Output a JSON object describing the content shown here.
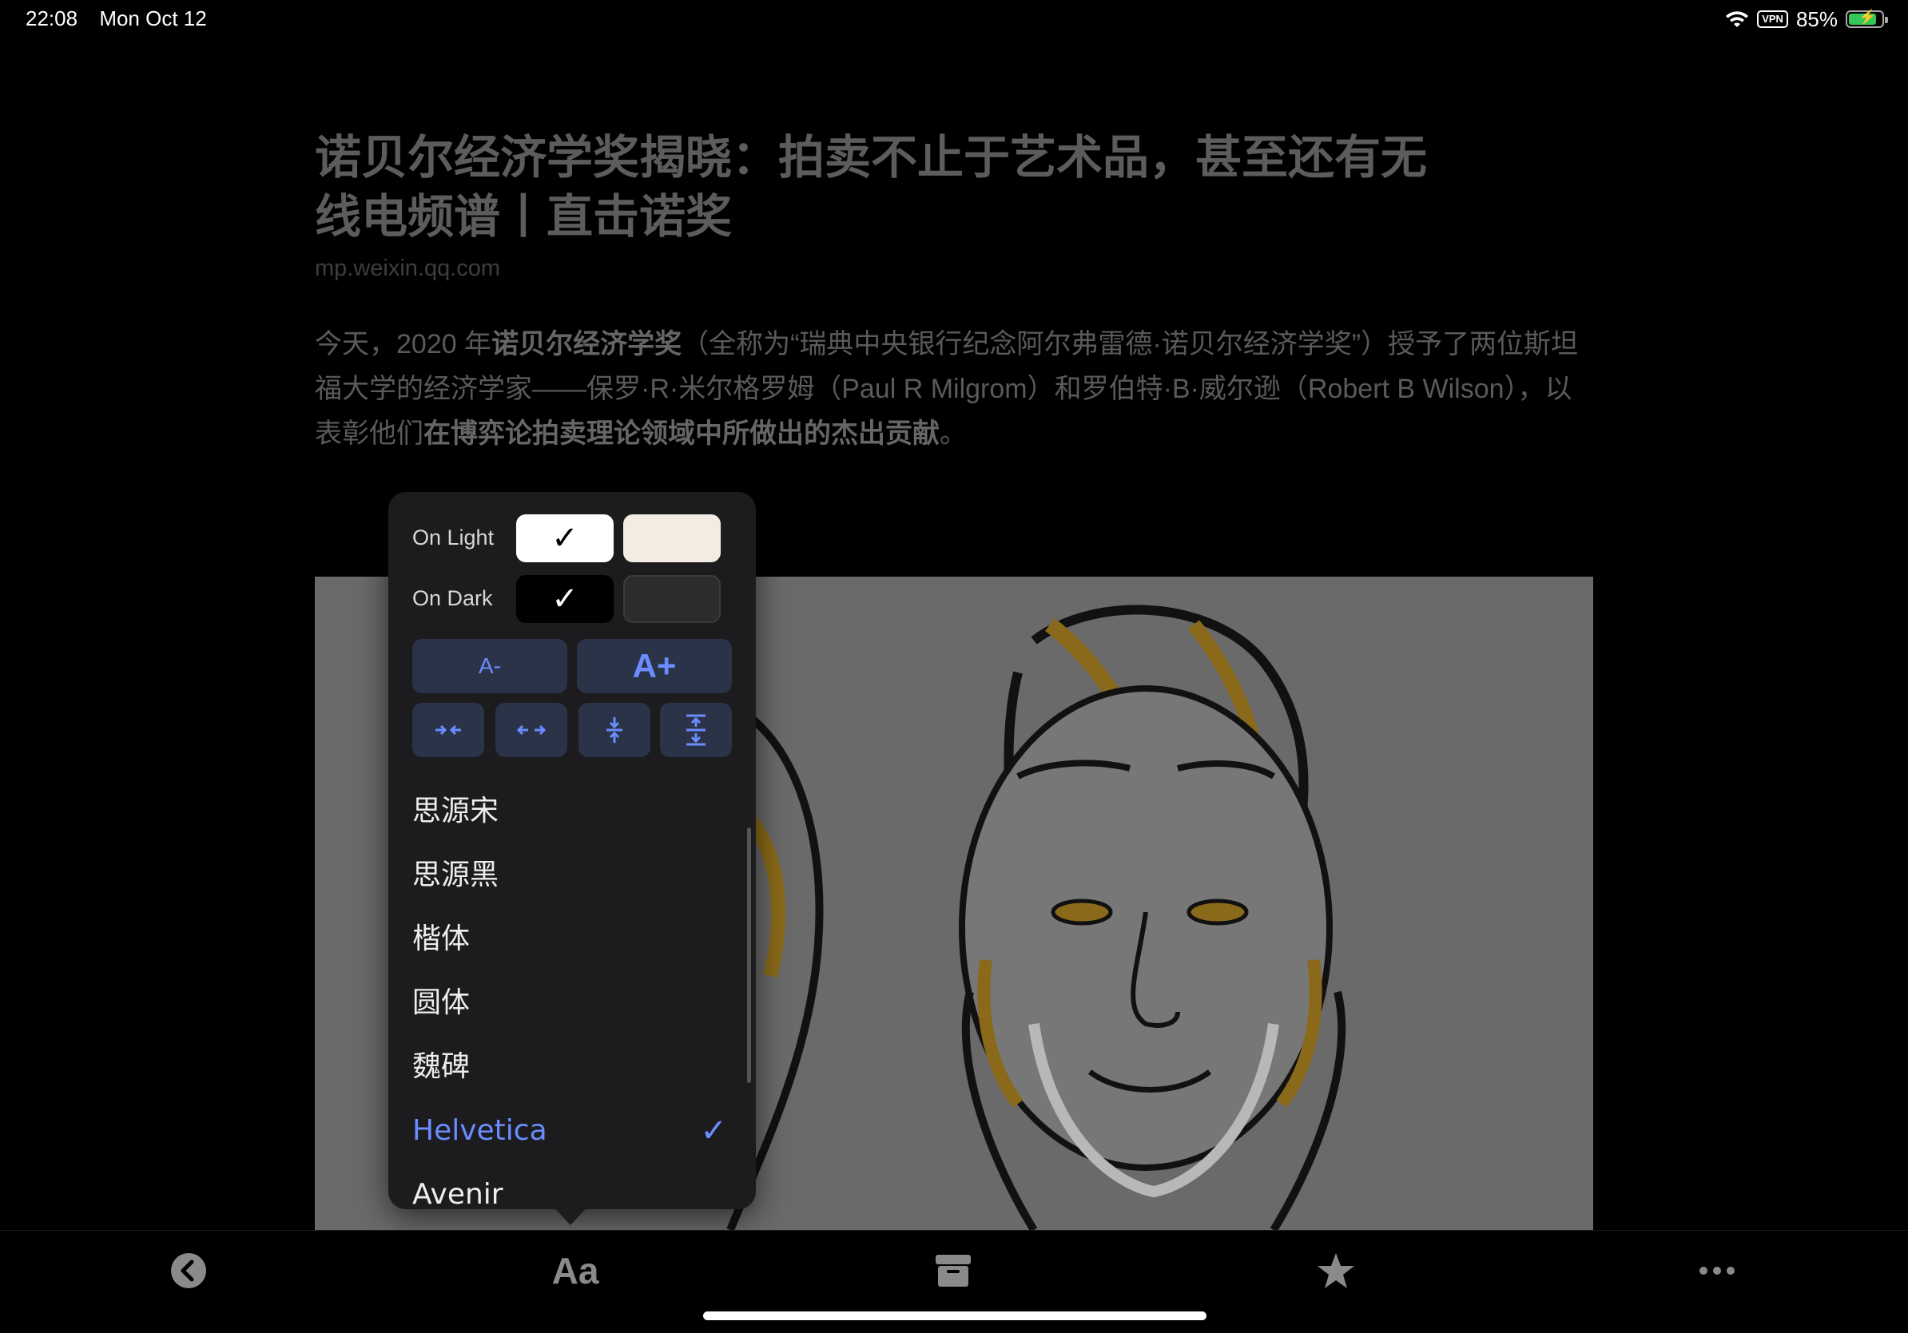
{
  "status_bar": {
    "time": "22:08",
    "date": "Mon Oct 12",
    "vpn": "VPN",
    "battery": "85%",
    "battery_level": 0.85
  },
  "article": {
    "title": "诺贝尔经济学奖揭晓：拍卖不止于艺术品，甚至还有无线电频谱丨直击诺奖",
    "source": "mp.weixin.qq.com",
    "para": [
      {
        "t": "今天，2020 年",
        "b": false
      },
      {
        "t": "诺贝尔经济学奖",
        "b": true
      },
      {
        "t": "（全称为“瑞典中央银行纪念阿尔弗雷德·诺贝尔经济学奖”）授予了两位斯坦福大学的经济学家——保罗·R·米尔格罗姆（Paul R Milgrom）和罗伯特·B·威尔逊（Robert B Wilson），以表彰他们",
        "b": false
      },
      {
        "t": "在博弈论拍卖理论领域中所做出的杰出贡献",
        "b": true
      },
      {
        "t": "。",
        "b": false
      }
    ]
  },
  "popover": {
    "on_light_label": "On Light",
    "on_dark_label": "On Dark",
    "check": "✓",
    "font_smaller": "A-",
    "font_larger": "A+",
    "fonts": [
      {
        "name": "思源宋",
        "selected": false
      },
      {
        "name": "思源黑",
        "selected": false
      },
      {
        "name": "楷体",
        "selected": false
      },
      {
        "name": "圆体",
        "selected": false
      },
      {
        "name": "魏碑",
        "selected": false
      },
      {
        "name": "Helvetica",
        "selected": true
      },
      {
        "name": "Avenir",
        "selected": false
      }
    ]
  },
  "toolbar": {
    "format_label": "Aa"
  },
  "colors": {
    "accent": "#6b8cff",
    "popover_bg": "#1c1c1e",
    "button_bg": "#2a3348"
  }
}
